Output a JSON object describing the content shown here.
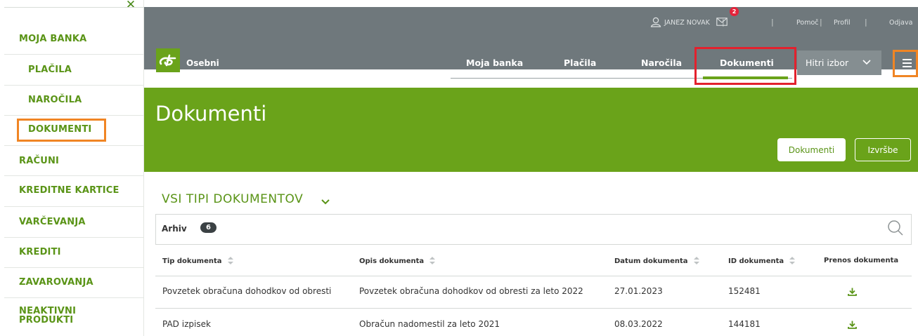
{
  "sidebar": {
    "close_icon": "close-icon",
    "items": [
      {
        "label": "MOJA BANKA"
      },
      {
        "label": "PLAČILA"
      },
      {
        "label": "NAROČILA"
      },
      {
        "label": "DOKUMENTI"
      },
      {
        "label": "RAČUNI"
      },
      {
        "label": "KREDITNE KARTICE"
      },
      {
        "label": "VARČEVANJA"
      },
      {
        "label": "KREDITI"
      },
      {
        "label": "ZAVAROVANJA"
      },
      {
        "label_line1": "NEAKTIVNI",
        "label_line2": "PRODUKTI"
      }
    ]
  },
  "header": {
    "user_name": "JANEZ NOVAK",
    "messages_count": "2",
    "links": [
      "Pomoč",
      "Profil",
      "Odjava"
    ],
    "brand": "Osebni",
    "nav": [
      "Moja banka",
      "Plačila",
      "Naročila",
      "Dokumenti"
    ],
    "active_nav": "Dokumenti",
    "quick_select": "Hitri izbor"
  },
  "banner": {
    "title": "Dokumenti",
    "btn_documents": "Dokumenti",
    "btn_statements": "Izvršbe"
  },
  "content": {
    "filter_title": "VSI TIPI DOKUMENTOV",
    "archive_label": "Arhiv",
    "archive_count": "6",
    "columns": [
      "Tip dokumenta",
      "Opis dokumenta",
      "Datum dokumenta",
      "ID dokumenta",
      "Prenos dokumenta"
    ],
    "rows": [
      {
        "type": "Povzetek obračuna dohodkov od obresti",
        "desc": "Povzetek obračuna dohodkov od obresti za leto 2022",
        "date": "27.01.2023",
        "id": "152481"
      },
      {
        "type": "PAD izpisek",
        "desc": "Obračun nadomestil za leto 2021",
        "date": "08.03.2022",
        "id": "144181"
      }
    ]
  },
  "colors": {
    "brand_green": "#6aa31a",
    "header_grey": "#6f787c",
    "highlight_orange": "#f08524",
    "highlight_red": "#e3212d"
  }
}
